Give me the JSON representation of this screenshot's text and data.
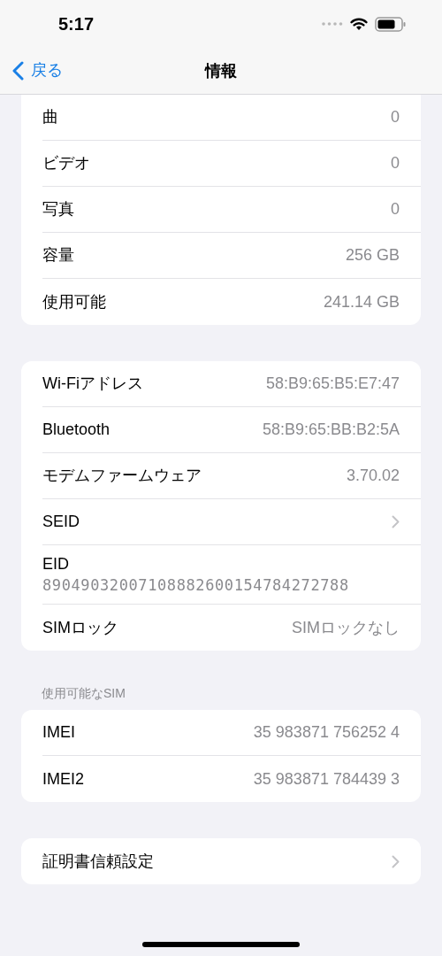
{
  "status_bar": {
    "time": "5:17"
  },
  "nav": {
    "back": "戻る",
    "title": "情報"
  },
  "sections": [
    {
      "rows": [
        {
          "kind": "value",
          "label": "曲",
          "value": "0"
        },
        {
          "kind": "value",
          "label": "ビデオ",
          "value": "0"
        },
        {
          "kind": "value",
          "label": "写真",
          "value": "0"
        },
        {
          "kind": "value",
          "label": "容量",
          "value": "256 GB"
        },
        {
          "kind": "value",
          "label": "使用可能",
          "value": "241.14 GB"
        }
      ],
      "clipped": true
    },
    {
      "rows": [
        {
          "kind": "value",
          "label": "Wi-Fiアドレス",
          "value": "58:B9:65:B5:E7:47"
        },
        {
          "kind": "value",
          "label": "Bluetooth",
          "value": "58:B9:65:BB:B2:5A"
        },
        {
          "kind": "value",
          "label": "モデムファームウェア",
          "value": "3.70.02"
        },
        {
          "kind": "chevron",
          "label": "SEID"
        },
        {
          "kind": "stacked",
          "label": "EID",
          "value": "89049032007108882600154784272788"
        },
        {
          "kind": "value",
          "label": "SIMロック",
          "value": "SIMロックなし"
        }
      ]
    },
    {
      "header": "使用可能なSIM",
      "rows": [
        {
          "kind": "value",
          "label": "IMEI",
          "value": "35 983871 756252 4"
        },
        {
          "kind": "value",
          "label": "IMEI2",
          "value": "35 983871 784439 3"
        }
      ]
    },
    {
      "rows": [
        {
          "kind": "chevron",
          "label": "証明書信頼設定"
        }
      ]
    }
  ]
}
